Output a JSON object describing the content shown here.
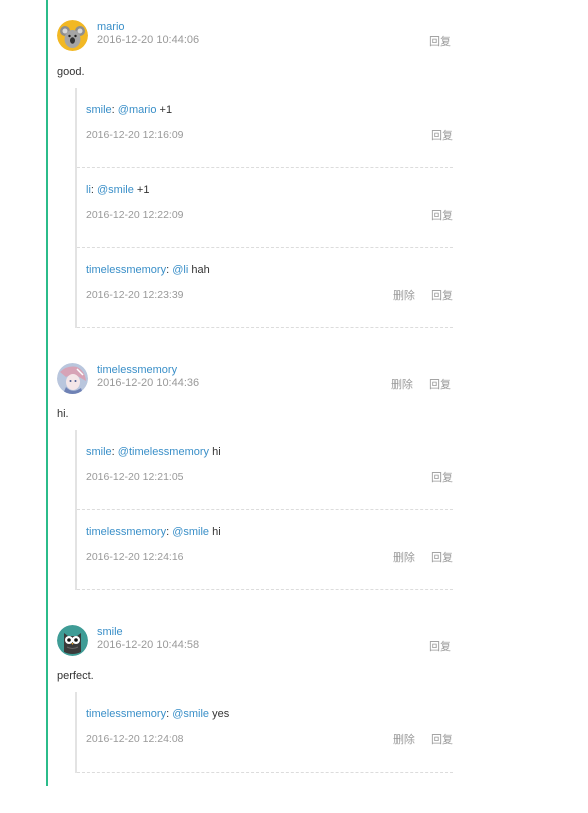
{
  "threads": [
    {
      "user": "mario",
      "time": "2016-12-20 10:44:06",
      "text": "good.",
      "actions": {
        "reply": "回复"
      },
      "replies": [
        {
          "user": "smile",
          "mention": "@mario",
          "text": "+1",
          "time": "2016-12-20 12:16:09",
          "delete": "",
          "reply": "回复"
        },
        {
          "user": "li",
          "mention": "@smile",
          "text": "+1",
          "time": "2016-12-20 12:22:09",
          "delete": "",
          "reply": "回复"
        },
        {
          "user": "timelessmemory",
          "mention": "@li",
          "text": "hah",
          "time": "2016-12-20 12:23:39",
          "delete": "删除",
          "reply": "回复"
        }
      ]
    },
    {
      "user": "timelessmemory",
      "time": "2016-12-20 10:44:36",
      "text": "hi.",
      "actions": {
        "delete": "删除",
        "reply": "回复"
      },
      "replies": [
        {
          "user": "smile",
          "mention": "@timelessmemory",
          "text": "hi",
          "time": "2016-12-20 12:21:05",
          "delete": "",
          "reply": "回复"
        },
        {
          "user": "timelessmemory",
          "mention": "@smile",
          "text": "hi",
          "time": "2016-12-20 12:24:16",
          "delete": "删除",
          "reply": "回复"
        }
      ]
    },
    {
      "user": "smile",
      "time": "2016-12-20 10:44:58",
      "text": "perfect.",
      "actions": {
        "reply": "回复"
      },
      "replies": [
        {
          "user": "timelessmemory",
          "mention": "@smile",
          "text": "yes",
          "time": "2016-12-20 12:24:08",
          "delete": "删除",
          "reply": "回复"
        }
      ]
    }
  ],
  "colors": {
    "accent": "#2bbc8a",
    "link": "#3a8fc8",
    "muted": "#999999"
  },
  "icons": [
    "koala-avatar-icon",
    "anime-avatar-icon",
    "owl-avatar-icon"
  ]
}
